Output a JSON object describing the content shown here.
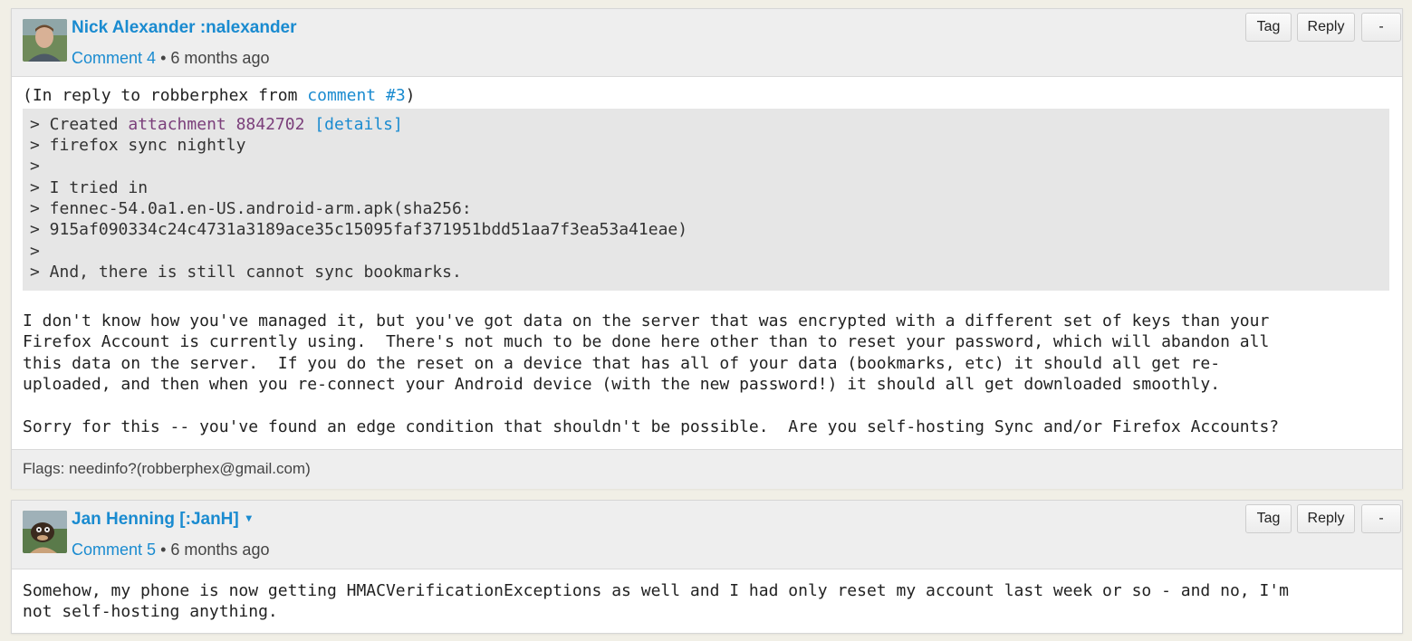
{
  "comments": [
    {
      "author": "Nick Alexander :nalexander",
      "comment_label": "Comment 4",
      "separator": "•",
      "age": "6 months ago",
      "buttons": {
        "tag": "Tag",
        "reply": "Reply",
        "collapse": "-"
      },
      "reply_prefix": "(In reply to robberphex from ",
      "reply_link": "comment #3",
      "reply_suffix": ")",
      "quote": {
        "line1_prefix": "> Created ",
        "attachment_link": "attachment 8842702",
        "details_link": "[details]",
        "lines": [
          "> firefox sync nightly",
          ">",
          "> I tried in",
          "> fennec-54.0a1.en-US.android-arm.apk(sha256:",
          "> 915af090334c24c4731a3189ace35c15095faf371951bdd51aa7f3ea53a41eae)",
          ">",
          "> And, there is still cannot sync bookmarks."
        ]
      },
      "paragraph1": [
        "I don't know how you've managed it, but you've got data on the server that was encrypted with a different set of keys than your",
        "Firefox Account is currently using.  There's not much to be done here other than to reset your password, which will abandon all",
        "this data on the server.  If you do the reset on a device that has all of your data (bookmarks, etc) it should all get re-",
        "uploaded, and then when you re-connect your Android device (with the new password!) it should all get downloaded smoothly."
      ],
      "paragraph2": "Sorry for this -- you've found an edge condition that shouldn't be possible.  Are you self-hosting Sync and/or Firefox Accounts?",
      "flags": "Flags: needinfo?(robberphex@gmail.com)"
    },
    {
      "author": "Jan Henning [:JanH]",
      "author_caret": "▾",
      "comment_label": "Comment 5",
      "separator": "•",
      "age": "6 months ago",
      "buttons": {
        "tag": "Tag",
        "reply": "Reply",
        "collapse": "-"
      },
      "lines": [
        "Somehow, my phone is now getting HMACVerificationExceptions as well and I had only reset my account last week or so - and no, I'm",
        "not self-hosting anything."
      ]
    }
  ],
  "colors": {
    "link": "#1a8bd0",
    "attachment": "#7b3f7b",
    "header_bg": "#eeeeee",
    "quote_bg": "#e6e6e6",
    "page_bg": "#f1efe6"
  }
}
